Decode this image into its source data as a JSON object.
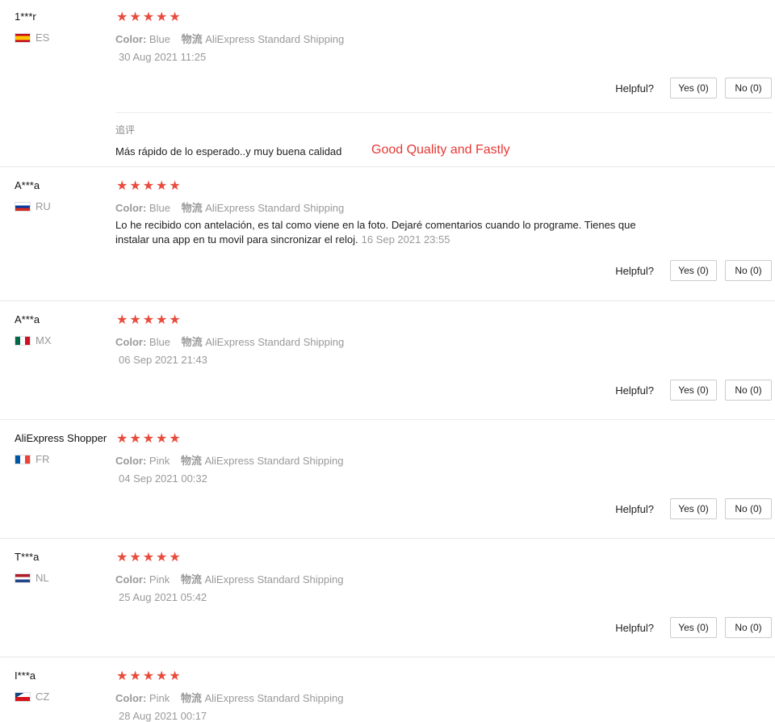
{
  "helpful_label": "Helpful?",
  "colors": {
    "star": "#e84c3d",
    "annotation": "#e53935"
  },
  "reviews": [
    {
      "user": "1***r",
      "country": "ES",
      "flag_icon": "flag-es-icon",
      "rating": "★★★★★",
      "attr_key1": "Color:",
      "attr_val1": "Blue",
      "attr_key2": "物流",
      "attr_val2": "AliExpress Standard Shipping",
      "date": "30 Aug 2021 11:25",
      "yes": "Yes (0)",
      "no": "No (0)",
      "followup_title": "追评",
      "followup_text": "Más rápido de lo esperado..y muy buena calidad",
      "annotation": "Good Quality and Fastly"
    },
    {
      "user": "A***a",
      "country": "RU",
      "flag_icon": "flag-ru-icon",
      "rating": "★★★★★",
      "attr_key1": "Color:",
      "attr_val1": "Blue",
      "attr_key2": "物流",
      "attr_val2": "AliExpress Standard Shipping",
      "text_line1": "Lo he recibido con antelación, es tal como viene en la foto. Dejaré comentarios cuando lo programe. Tienes que",
      "text_line2": "instalar una app en tu movil para sincronizar el reloj.",
      "date": "16 Sep 2021 23:55",
      "yes": "Yes (0)",
      "no": "No (0)"
    },
    {
      "user": "A***a",
      "country": "MX",
      "flag_icon": "flag-mx-icon",
      "rating": "★★★★★",
      "attr_key1": "Color:",
      "attr_val1": "Blue",
      "attr_key2": "物流",
      "attr_val2": "AliExpress Standard Shipping",
      "date": "06 Sep 2021 21:43",
      "yes": "Yes (0)",
      "no": "No (0)"
    },
    {
      "user": "AliExpress Shopper",
      "country": "FR",
      "flag_icon": "flag-fr-icon",
      "rating": "★★★★★",
      "attr_key1": "Color:",
      "attr_val1": "Pink",
      "attr_key2": "物流",
      "attr_val2": "AliExpress Standard Shipping",
      "date": "04 Sep 2021 00:32",
      "yes": "Yes (0)",
      "no": "No (0)"
    },
    {
      "user": "T***a",
      "country": "NL",
      "flag_icon": "flag-nl-icon",
      "rating": "★★★★★",
      "attr_key1": "Color:",
      "attr_val1": "Pink",
      "attr_key2": "物流",
      "attr_val2": "AliExpress Standard Shipping",
      "date": "25 Aug 2021 05:42",
      "yes": "Yes (0)",
      "no": "No (0)"
    },
    {
      "user": "I***a",
      "country": "CZ",
      "flag_icon": "flag-cz-icon",
      "rating": "★★★★★",
      "attr_key1": "Color:",
      "attr_val1": "Pink",
      "attr_key2": "物流",
      "attr_val2": "AliExpress Standard Shipping",
      "date": "28 Aug 2021 00:17"
    }
  ]
}
